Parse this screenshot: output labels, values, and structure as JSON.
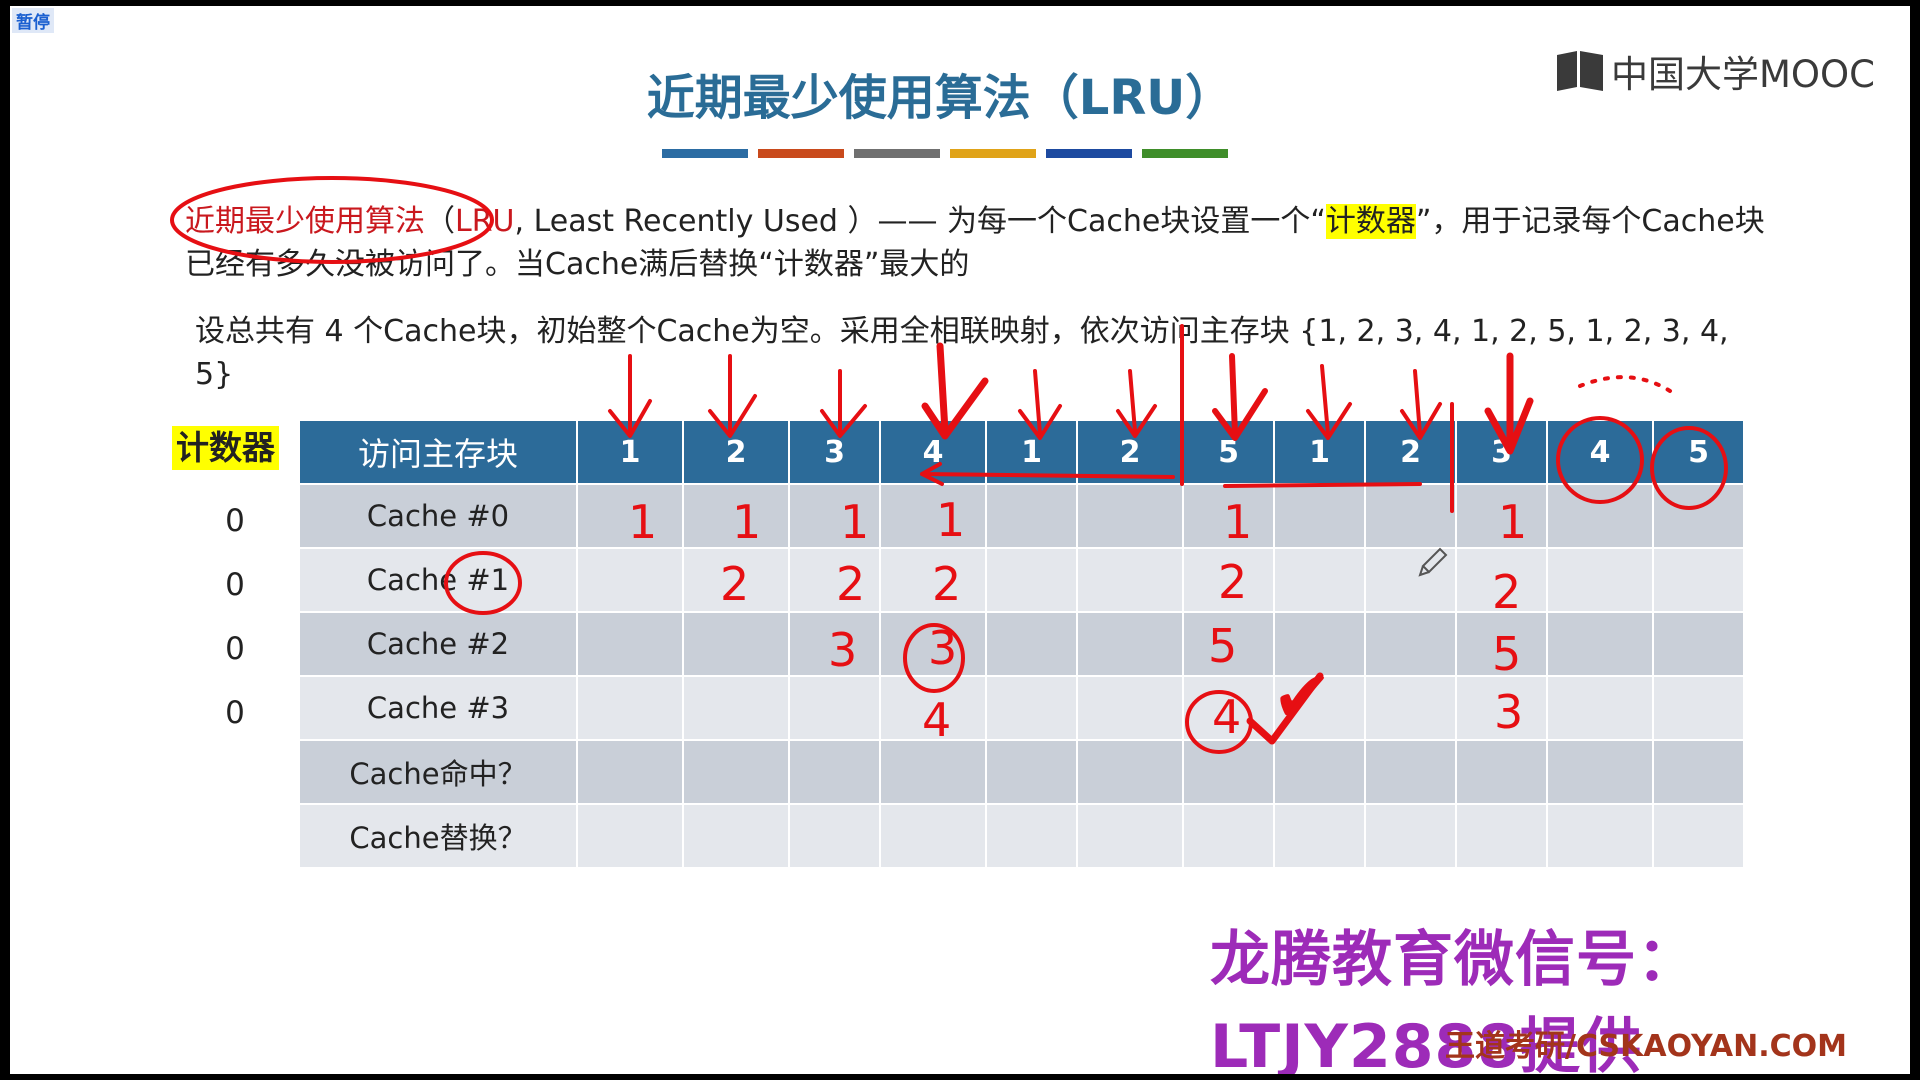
{
  "overlay": {
    "pause": "暂停"
  },
  "slide": {
    "title": "近期最少使用算法（LRU）",
    "title_bar_colors": [
      "#2b6ca3",
      "#c94a1c",
      "#707070",
      "#e0a318",
      "#1d4aa0",
      "#3f8e2a"
    ],
    "logo": "中国大学MOOC",
    "definition": {
      "term": "近期最少使用算法",
      "abbr": "LRU",
      "desc": ", Least Recently Used ）—— 为每一个Cache块设置一个“",
      "counter_word": "计数器",
      "rest": "”，用于记录每个Cache块已经有多久没被访问了。当Cache满后替换“计数器”最大的"
    },
    "assumption": "设总共有 4 个Cache块，初始整个Cache为空。采用全相联映射，依次访问主存块 {1, 2, 3, 4, 1, 2, 5, 1, 2, 3, 4, 5}",
    "counter_label": "计数器",
    "counters": [
      "0",
      "0",
      "0",
      "0"
    ],
    "table": {
      "header_label": "访问主存块",
      "sequence": [
        "1",
        "2",
        "3",
        "4",
        "1",
        "2",
        "5",
        "1",
        "2",
        "3",
        "4",
        "5"
      ],
      "rows": [
        "Cache #0",
        "Cache #1",
        "Cache #2",
        "Cache #3",
        "Cache命中？",
        "Cache替换？"
      ]
    },
    "handwriting": {
      "cache0": [
        "1",
        "1",
        "1",
        "1",
        "1",
        "1"
      ],
      "cache1": [
        "2",
        "2",
        "2",
        "2",
        "2"
      ],
      "cache2": [
        "3",
        "3",
        "5",
        "5"
      ],
      "cache3": [
        "4",
        "4",
        "3"
      ],
      "check": "✔"
    },
    "promo": "龙腾教育微信号：LTJY2888提供",
    "site": "王道考研/CSKAOYAN.COM"
  }
}
